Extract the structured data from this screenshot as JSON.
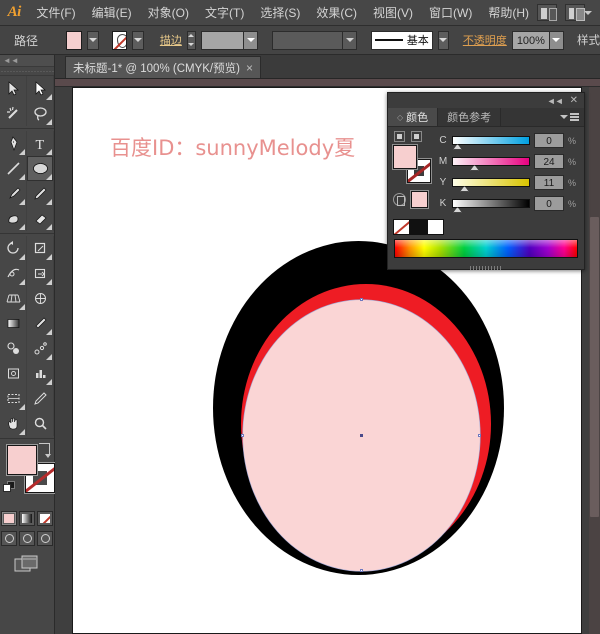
{
  "app": {
    "logo": "Ai",
    "menus": [
      {
        "label": "文件(F)",
        "name": "menu-file"
      },
      {
        "label": "编辑(E)",
        "name": "menu-edit"
      },
      {
        "label": "对象(O)",
        "name": "menu-object"
      },
      {
        "label": "文字(T)",
        "name": "menu-type"
      },
      {
        "label": "选择(S)",
        "name": "menu-select"
      },
      {
        "label": "效果(C)",
        "name": "menu-effect"
      },
      {
        "label": "视图(V)",
        "name": "menu-view"
      },
      {
        "label": "窗口(W)",
        "name": "menu-window"
      },
      {
        "label": "帮助(H)",
        "name": "menu-help"
      }
    ]
  },
  "control_bar": {
    "selection_label": "路径",
    "fill_color": "#f5cfcf",
    "stroke_label": "描边",
    "stroke_weight": "",
    "brush_label": "基本",
    "opacity_label": "不透明度",
    "opacity_value": "100%",
    "styles_label": "样式"
  },
  "document": {
    "tab_title": "未标题-1* @ 100% (CMYK/预览)",
    "close_glyph": "×",
    "zoom": "100%",
    "color_mode": "CMYK/预览"
  },
  "artwork": {
    "text": "百度ID：sunnyMelody夏",
    "text_color": "#e8918f",
    "outer_ellipse_color": "#000000",
    "ring_color": "#ee1c24",
    "inner_ellipse_color": "#fad5d5"
  },
  "color_panel": {
    "tabs": [
      {
        "label": "颜色",
        "active": true
      },
      {
        "label": "颜色参考",
        "active": false
      }
    ],
    "collapse_glyph": "◄◄",
    "close_glyph": "✕",
    "mode": "CMYK",
    "sliders": [
      {
        "label": "C",
        "value": "0",
        "unit": "%"
      },
      {
        "label": "M",
        "value": "24",
        "unit": "%"
      },
      {
        "label": "Y",
        "value": "11",
        "unit": "%"
      },
      {
        "label": "K",
        "value": "0",
        "unit": "%"
      }
    ],
    "fill_color": "#f7cfcf",
    "stroke_color": "none",
    "quick_swatches": [
      "none",
      "#111111",
      "#ffffff"
    ]
  },
  "toolbar": {
    "tools": [
      {
        "name": "selection-tool",
        "sel": false
      },
      {
        "name": "direct-selection-tool",
        "sel": false
      },
      {
        "name": "magic-wand-tool",
        "sel": false
      },
      {
        "name": "lasso-tool",
        "sel": false
      },
      {
        "name": "pen-tool",
        "sel": false
      },
      {
        "name": "type-tool",
        "sel": false
      },
      {
        "name": "line-segment-tool",
        "sel": false
      },
      {
        "name": "ellipse-tool",
        "sel": true
      },
      {
        "name": "paintbrush-tool",
        "sel": false
      },
      {
        "name": "pencil-tool",
        "sel": false
      },
      {
        "name": "blob-brush-tool",
        "sel": false
      },
      {
        "name": "eraser-tool",
        "sel": false
      },
      {
        "name": "rotate-tool",
        "sel": false
      },
      {
        "name": "scale-tool",
        "sel": false
      },
      {
        "name": "width-tool",
        "sel": false
      },
      {
        "name": "shape-builder-tool",
        "sel": false
      },
      {
        "name": "perspective-grid-tool",
        "sel": false
      },
      {
        "name": "mesh-tool",
        "sel": false
      },
      {
        "name": "gradient-tool",
        "sel": false
      },
      {
        "name": "eyedropper-tool",
        "sel": false
      },
      {
        "name": "blend-tool",
        "sel": false
      },
      {
        "name": "symbol-sprayer-tool",
        "sel": false
      },
      {
        "name": "column-graph-tool",
        "sel": false
      },
      {
        "name": "artboard-tool",
        "sel": false
      },
      {
        "name": "slice-tool",
        "sel": false
      },
      {
        "name": "hand-tool",
        "sel": false
      },
      {
        "name": "zoom-tool",
        "sel": false
      }
    ],
    "fill_color": "#f7cfcf",
    "stroke_color": "none"
  }
}
